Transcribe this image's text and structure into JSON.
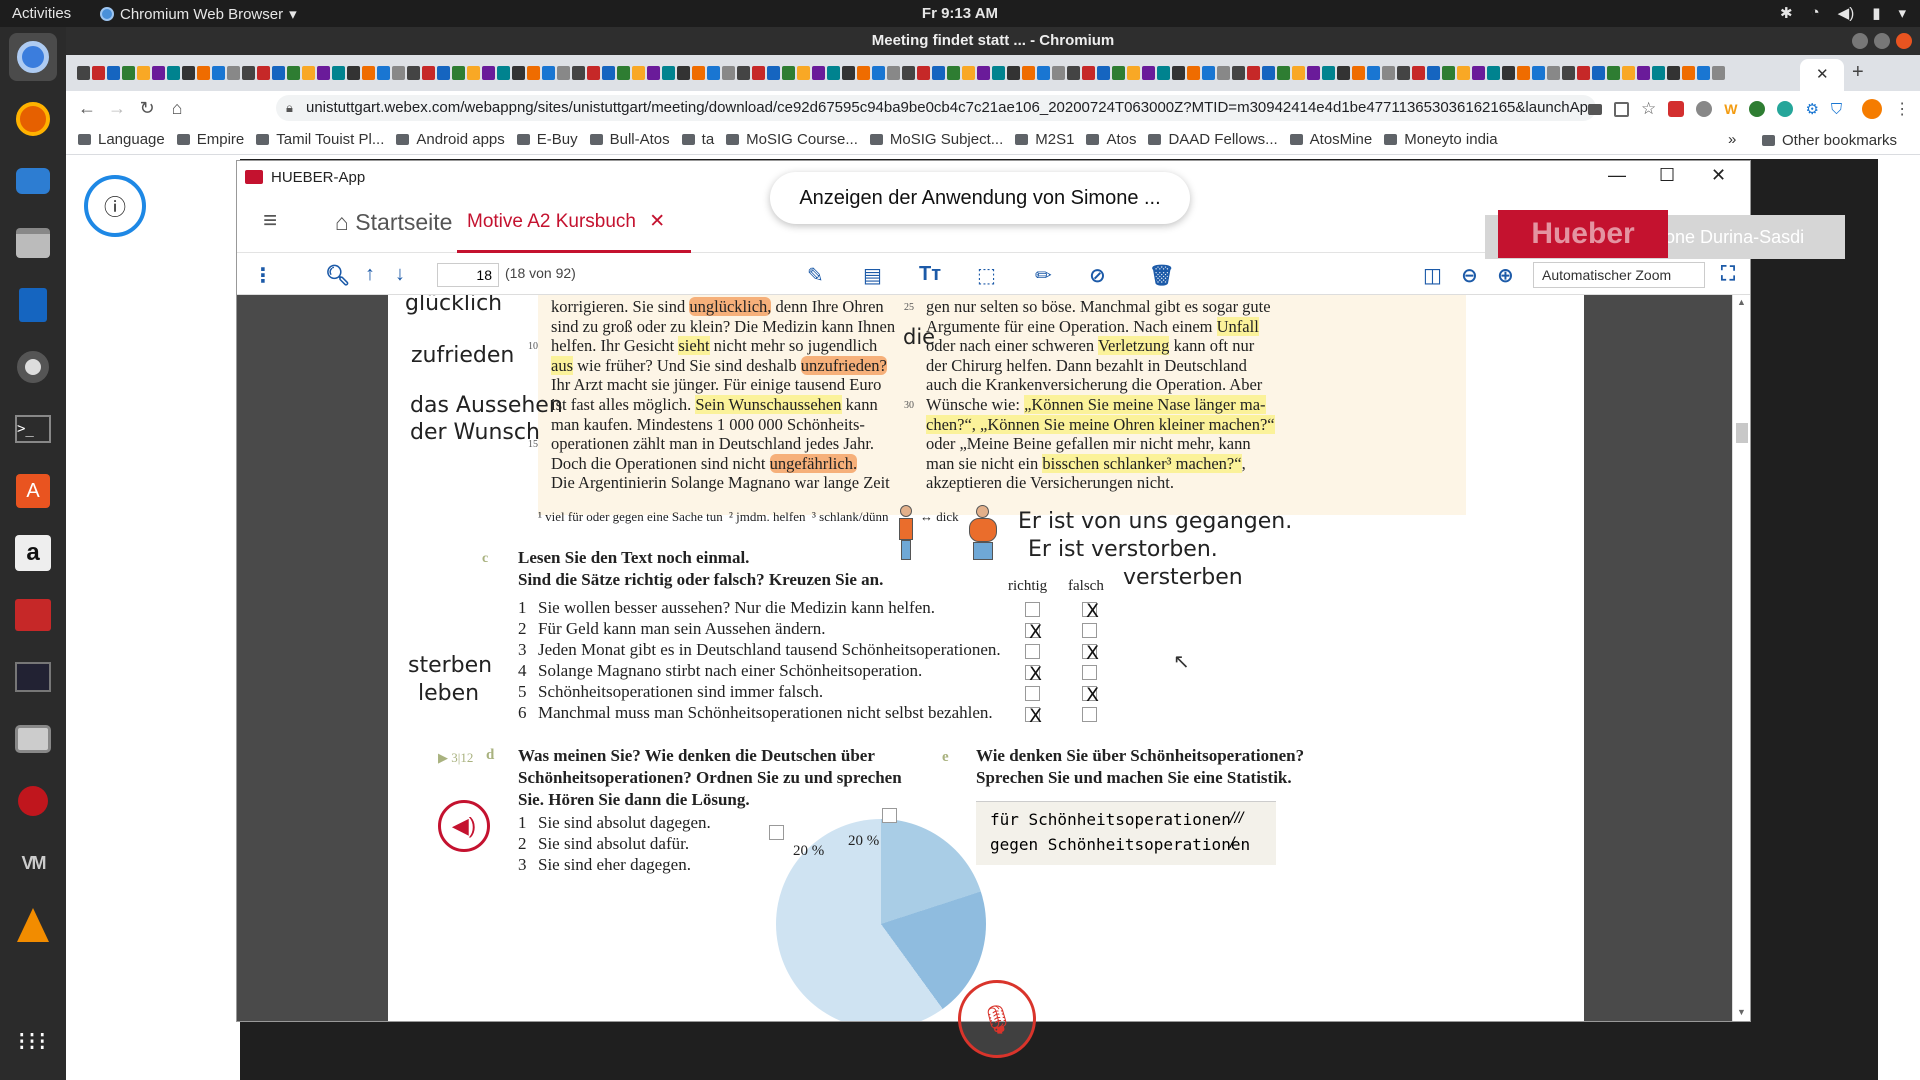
{
  "topbar": {
    "activities": "Activities",
    "app_menu": "Chromium Web Browser",
    "clock": "Fr  9:13 AM"
  },
  "chrome": {
    "window_title": "Meeting findet statt ... - Chromium",
    "url": "unistuttgart.webex.com/webappng/sites/unistuttgart/meeting/download/ce92d67595c94ba9be0cb4c7c21ae106_20200724T063000Z?MTID=m30942414e4d1be477113653036162165&launchApp...",
    "bookmarks": [
      "Language",
      "Empire",
      "Tamil Touist Pl...",
      "Android apps",
      "E-Buy",
      "Bull-Atos",
      "ta",
      "MoSIG Course...",
      "MoSIG Subject...",
      "M2S1",
      "Atos",
      "DAAD Fellows...",
      "AtosMine",
      "Moneyto india"
    ],
    "more": "»",
    "other_bookmarks": "Other bookmarks"
  },
  "webex": {
    "share_banner": "Anzeigen der Anwendung von Simone ...",
    "speaker": "Es spricht: Simone Durina-Sasdi",
    "hueber_logo": "Hueber"
  },
  "hueber": {
    "title": "HUEBER-App",
    "home": "Startseite",
    "tab": "Motive A2 Kursbuch",
    "page_input": "18",
    "page_info": "(18 von 92)",
    "zoom": "Automatischer Zoom"
  },
  "pdf": {
    "left_col": [
      {
        "no": "",
        "parts": [
          {
            "t": "korrigieren. Sie sind "
          },
          {
            "t": "unglücklich,",
            "hl": "o"
          },
          {
            "t": " denn Ihre Ohren"
          }
        ]
      },
      {
        "no": "",
        "parts": [
          {
            "t": "sind zu groß oder zu klein? Die Medizin kann Ihnen"
          }
        ]
      },
      {
        "no": "10",
        "parts": [
          {
            "t": "helfen. Ihr Gesicht "
          },
          {
            "t": "sieht",
            "hl": "y"
          },
          {
            "t": " nicht mehr so jugendlich"
          }
        ]
      },
      {
        "no": "",
        "parts": [
          {
            "t": "aus",
            "hl": "y"
          },
          {
            "t": " wie früher? Und Sie sind deshalb "
          },
          {
            "t": "unzufrieden?",
            "hl": "o"
          }
        ]
      },
      {
        "no": "",
        "parts": [
          {
            "t": "Ihr Arzt macht sie jünger. Für einige tausend Euro"
          }
        ]
      },
      {
        "no": "",
        "parts": [
          {
            "t": "ist fast alles möglich. "
          },
          {
            "t": "Sein Wunschaussehen",
            "hl": "y"
          },
          {
            "t": " kann"
          }
        ]
      },
      {
        "no": "",
        "parts": [
          {
            "t": "man kaufen. Mindestens 1 000 000 Schönheits-"
          }
        ]
      },
      {
        "no": "15",
        "parts": [
          {
            "t": "operationen zählt man in Deutschland jedes Jahr."
          }
        ]
      },
      {
        "no": "",
        "parts": [
          {
            "t": "Doch die Operationen sind nicht "
          },
          {
            "t": "ungefährlich.",
            "hl": "o"
          }
        ]
      },
      {
        "no": "",
        "parts": [
          {
            "t": "Die Argentinierin Solange Magnano war lange Zeit"
          }
        ]
      }
    ],
    "right_col": [
      {
        "no": "25",
        "parts": [
          {
            "t": "gen nur selten so böse. Manchmal gibt es sogar gute"
          }
        ]
      },
      {
        "no": "",
        "parts": [
          {
            "t": "Argumente für eine Operation. Nach einem "
          },
          {
            "t": "Unfall",
            "hl": "y"
          }
        ]
      },
      {
        "no": "",
        "parts": [
          {
            "t": "oder nach einer schweren "
          },
          {
            "t": "Verletzung",
            "hl": "y"
          },
          {
            "t": " kann oft nur"
          }
        ]
      },
      {
        "no": "",
        "parts": [
          {
            "t": "der Chirurg helfen. Dann bezahlt in Deutschland"
          }
        ]
      },
      {
        "no": "",
        "parts": [
          {
            "t": "auch die Krankenversicherung die Operation. Aber"
          }
        ]
      },
      {
        "no": "30",
        "parts": [
          {
            "t": "Wünsche wie: "
          },
          {
            "t": "„Können Sie meine Nase länger ma-",
            "hl": "y"
          }
        ]
      },
      {
        "no": "",
        "parts": [
          {
            "t": "chen?“, „Können Sie meine Ohren kleiner machen?“",
            "hl": "y"
          }
        ]
      },
      {
        "no": "",
        "parts": [
          {
            "t": "oder „Meine Beine gefallen mir nicht mehr, kann"
          }
        ]
      },
      {
        "no": "",
        "parts": [
          {
            "t": "man sie nicht ein "
          },
          {
            "t": "bisschen schlanker³ machen?“",
            "hl": "y"
          },
          {
            "t": ","
          }
        ]
      },
      {
        "no": "",
        "parts": [
          {
            "t": "akzeptieren die Versicherungen nicht."
          }
        ]
      }
    ],
    "handwriting": {
      "glucklich": "glücklich",
      "zufrieden": "zufrieden",
      "aussehen": "das Aussehen",
      "wunsch": "der Wunsch",
      "die": "die",
      "gegangen": "Er ist von uns gegangen.",
      "verstorben": "Er ist verstorben.",
      "versterben": "versterben",
      "sterben": "sterben",
      "leben": "leben"
    },
    "footnotes": {
      "f1": "¹ viel für oder gegen eine Sache tun",
      "f2": "² jmdm. helfen",
      "f3": "³ schlank/dünn",
      "dick": "↔ dick"
    },
    "task_c": {
      "letter": "c",
      "line1": "Lesen Sie den Text noch einmal.",
      "line2": "Sind die Sätze richtig oder falsch? Kreuzen Sie an.",
      "col_richtig": "richtig",
      "col_falsch": "falsch",
      "statements": [
        {
          "no": "1",
          "text": "Sie wollen besser aussehen? Nur die Medizin kann helfen.",
          "mark": "falsch"
        },
        {
          "no": "2",
          "text": "Für Geld kann man sein Aussehen ändern.",
          "mark": "richtig"
        },
        {
          "no": "3",
          "text": "Jeden Monat gibt es in Deutschland tausend Schönheitsoperationen.",
          "mark": "falsch"
        },
        {
          "no": "4",
          "text": "Solange Magnano stirbt nach einer Schönheitsoperation.",
          "mark": "richtig"
        },
        {
          "no": "5",
          "text": "Schönheitsoperationen sind immer falsch.",
          "mark": "falsch"
        },
        {
          "no": "6",
          "text": "Manchmal muss man Schönheitsoperationen nicht selbst bezahlen.",
          "mark": "richtig"
        }
      ],
      "x": "X"
    },
    "task_d": {
      "track": "▶ 3|12",
      "letter": "d",
      "line1": "Was meinen Sie? Wie denken die Deutschen über",
      "line2": "Schönheitsoperationen? Ordnen Sie zu und sprechen",
      "line3": "Sie. Hören Sie dann die Lösung.",
      "items": [
        {
          "no": "1",
          "text": "Sie sind absolut dagegen."
        },
        {
          "no": "2",
          "text": "Sie sind absolut dafür."
        },
        {
          "no": "3",
          "text": "Sie sind eher dagegen."
        }
      ],
      "pie_labels": [
        "20 %",
        "20 %"
      ]
    },
    "task_e": {
      "letter": "e",
      "line1": "Wie denken Sie über Schönheitsoperationen?",
      "line2": "Sprechen Sie und machen Sie eine Statistik.",
      "row1_label": "für Schönheitsoperationen",
      "row1_tally": "///",
      "row2_label": "gegen Schönheitsoperationen",
      "row2_tally": "/"
    }
  }
}
